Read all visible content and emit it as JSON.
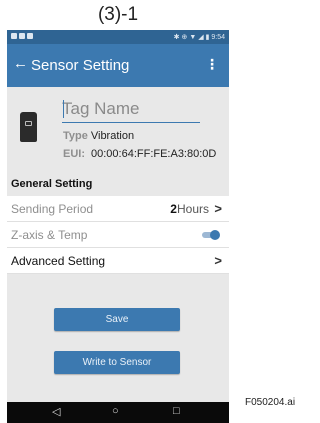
{
  "caption": "(3)-1",
  "status_bar": {
    "left_icons": [
      "notification-icon",
      "notification-icon",
      "notification-icon"
    ],
    "right_icons": [
      "bluetooth-icon",
      "data-icon",
      "wifi-icon",
      "signal-icon",
      "battery-icon"
    ],
    "time": "9:54"
  },
  "app_bar": {
    "back_icon": "back-arrow-icon",
    "title": "Sensor Setting",
    "menu_icon": "more-vertical-icon"
  },
  "device": {
    "icon": "sensor-device-icon",
    "tag_placeholder": "Tag Name",
    "tag_value": "",
    "type_label": "Type",
    "type_value": "Vibration",
    "eui_label": "EUI:",
    "eui_value": "00:00:64:FF:FE:A3:80:0D"
  },
  "general_setting": {
    "header": "General Setting",
    "sending_period": {
      "label": "Sending Period",
      "value_number": "2",
      "value_unit": "Hours"
    },
    "z_axis_temp": {
      "label": "Z-axis & Temp",
      "enabled": true
    }
  },
  "advanced_setting": {
    "label": "Advanced Setting"
  },
  "buttons": {
    "save": "Save",
    "write": "Write to Sensor"
  },
  "colors": {
    "primary": "#3c79b0",
    "status_bar": "#2f6493",
    "background": "#e8e8e8"
  },
  "footnote": "F050204.ai"
}
